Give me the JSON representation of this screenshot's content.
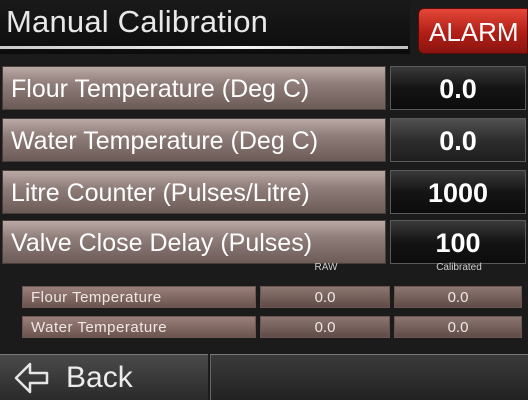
{
  "header": {
    "title": "Manual Calibration",
    "alarm_label": "ALARM"
  },
  "rows": [
    {
      "label": "Flour Temperature (Deg C)",
      "value": "0.0"
    },
    {
      "label": "Water Temperature (Deg C)",
      "value": "0.0"
    },
    {
      "label": "Litre Counter (Pulses/Litre)",
      "value": "1000"
    },
    {
      "label": "Valve Close Delay (Pulses)",
      "value": "100"
    }
  ],
  "table": {
    "columns": [
      "RAW",
      "Calibrated"
    ],
    "rows": [
      {
        "label": "Flour Temperature",
        "raw": "0.0",
        "calibrated": "0.0"
      },
      {
        "label": "Water Temperature",
        "raw": "0.0",
        "calibrated": "0.0"
      }
    ]
  },
  "footer": {
    "back_label": "Back",
    "back_icon": "back-arrow-icon"
  },
  "colors": {
    "alarm": "#c0281d",
    "label_bg": "#8f7d79",
    "value_bg": "#141414"
  }
}
